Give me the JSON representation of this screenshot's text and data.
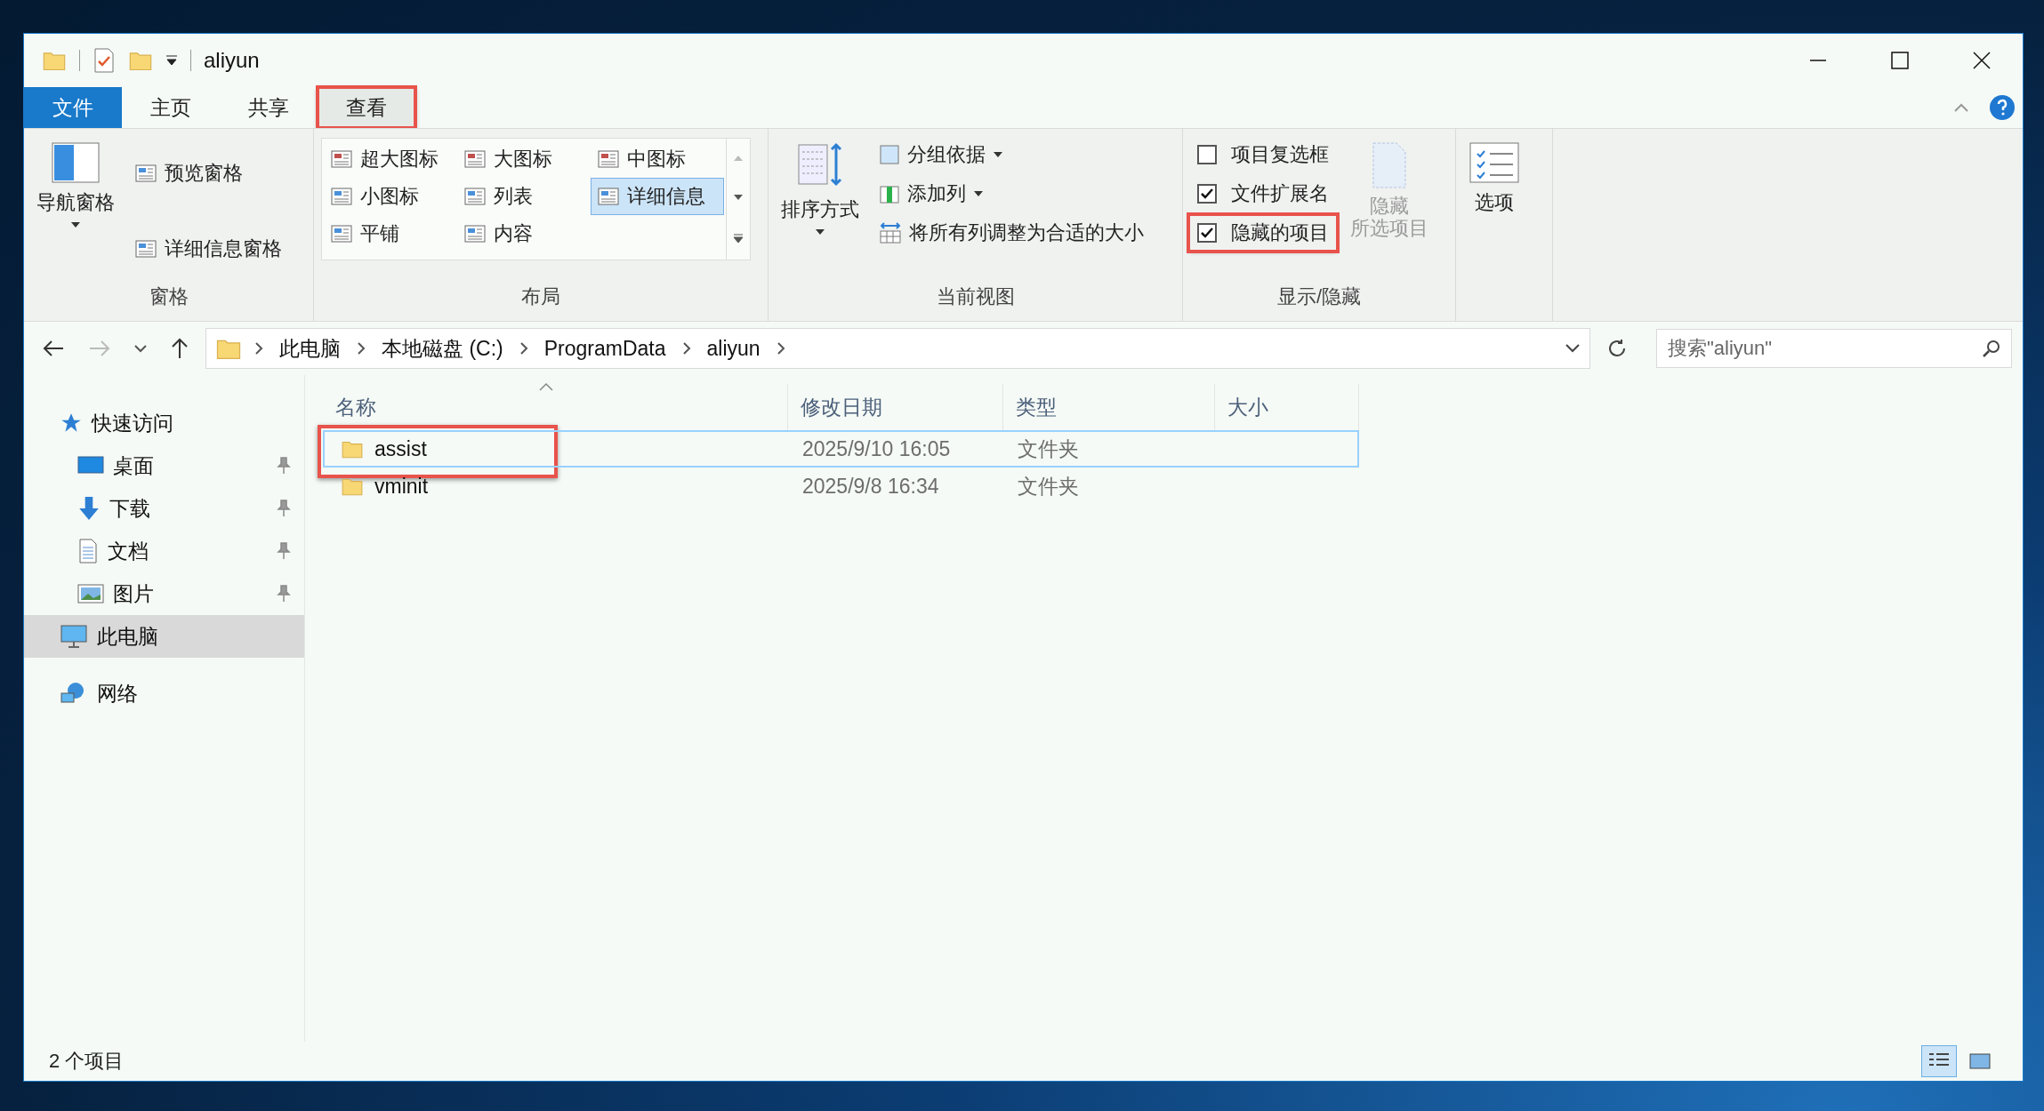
{
  "window": {
    "title": "aliyun"
  },
  "ribbon_tabs": [
    {
      "label": "文件",
      "kind": "file",
      "selected": false,
      "highlighted": false
    },
    {
      "label": "主页",
      "kind": "tab",
      "selected": false,
      "highlighted": false
    },
    {
      "label": "共享",
      "kind": "tab",
      "selected": false,
      "highlighted": false
    },
    {
      "label": "查看",
      "kind": "tab",
      "selected": true,
      "highlighted": true
    }
  ],
  "panes_group": {
    "label": "窗格",
    "navigation_pane": "导航窗格",
    "preview_pane": "预览窗格",
    "details_pane": "详细信息窗格"
  },
  "layout_group": {
    "label": "布局",
    "items": [
      {
        "label": "超大图标",
        "selected": false
      },
      {
        "label": "大图标",
        "selected": false
      },
      {
        "label": "中图标",
        "selected": false
      },
      {
        "label": "小图标",
        "selected": false
      },
      {
        "label": "列表",
        "selected": false
      },
      {
        "label": "详细信息",
        "selected": true
      },
      {
        "label": "平铺",
        "selected": false
      },
      {
        "label": "内容",
        "selected": false
      }
    ]
  },
  "current_view_group": {
    "label": "当前视图",
    "sort_by": "排序方式",
    "group_by": "分组依据",
    "add_columns": "添加列",
    "size_all_columns": "将所有列调整为合适的大小"
  },
  "show_hide_group": {
    "label": "显示/隐藏",
    "checkboxes": [
      {
        "label": "项目复选框",
        "checked": false,
        "highlighted": false
      },
      {
        "label": "文件扩展名",
        "checked": true,
        "highlighted": false
      },
      {
        "label": "隐藏的项目",
        "checked": true,
        "highlighted": true
      }
    ],
    "hide_selected": {
      "lines": [
        "隐藏",
        "所选项目"
      ],
      "disabled": true
    }
  },
  "options_button": "选项",
  "address_bar": {
    "path": [
      "此电脑",
      "本地磁盘 (C:)",
      "ProgramData",
      "aliyun"
    ]
  },
  "search": {
    "placeholder": "搜索\"aliyun\""
  },
  "sidebar": [
    {
      "label": "快速访问",
      "kind": "star",
      "selected": false,
      "children": [
        {
          "label": "桌面",
          "kind": "desktop",
          "selected": false
        },
        {
          "label": "下载",
          "kind": "download",
          "selected": false
        },
        {
          "label": "文档",
          "kind": "document",
          "selected": false
        },
        {
          "label": "图片",
          "kind": "pictures",
          "selected": false
        }
      ]
    },
    {
      "label": "此电脑",
      "kind": "pc",
      "selected": true
    },
    {
      "label": "网络",
      "kind": "network",
      "selected": false
    }
  ],
  "table": {
    "columns": [
      "名称",
      "修改日期",
      "类型",
      "大小"
    ],
    "rows": [
      {
        "name": "assist",
        "modified": "2025/9/10 16:05",
        "type": "文件夹",
        "selected": true,
        "highlighted": true
      },
      {
        "name": "vminit",
        "modified": "2025/9/8 16:34",
        "type": "文件夹",
        "selected": false,
        "highlighted": false
      }
    ]
  },
  "status_bar": {
    "text": "2 个项目",
    "view_buttons": [
      {
        "kind": "details",
        "selected": true
      },
      {
        "kind": "large",
        "selected": false
      }
    ]
  }
}
